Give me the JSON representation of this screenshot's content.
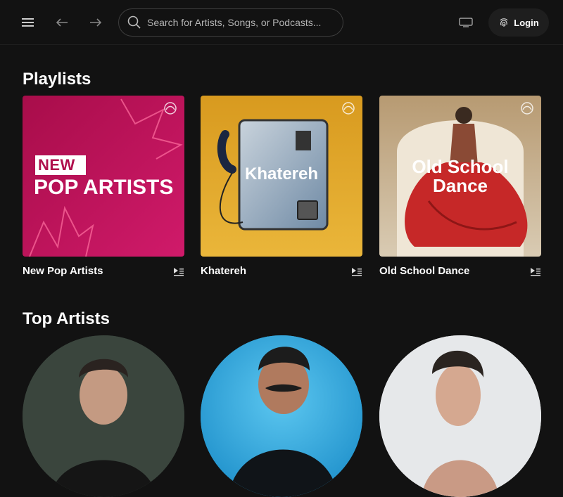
{
  "header": {
    "search_placeholder": "Search for Artists, Songs, or Podcasts...",
    "login_label": "Login",
    "icons": [
      "menu-icon",
      "back-arrow-icon",
      "forward-arrow-icon",
      "search-icon",
      "tv-icon",
      "fingerprint-icon"
    ]
  },
  "playlists": {
    "title": "Playlists",
    "items": [
      {
        "name": "New Pop Artists",
        "cover_badge": "NEW",
        "cover_text": "POP ARTISTS",
        "color": "#c2185b"
      },
      {
        "name": "Khatereh",
        "cover_text": "Khatereh",
        "color": "#e0a82e"
      },
      {
        "name": "Old School Dance",
        "cover_text_line1": "Old School",
        "cover_text_line2": "Dance",
        "color": "#c62828"
      }
    ]
  },
  "top_artists": {
    "title": "Top Artists"
  },
  "colors": {
    "background": "#121212",
    "text": "#ffffff",
    "muted": "#b3b3b3"
  }
}
